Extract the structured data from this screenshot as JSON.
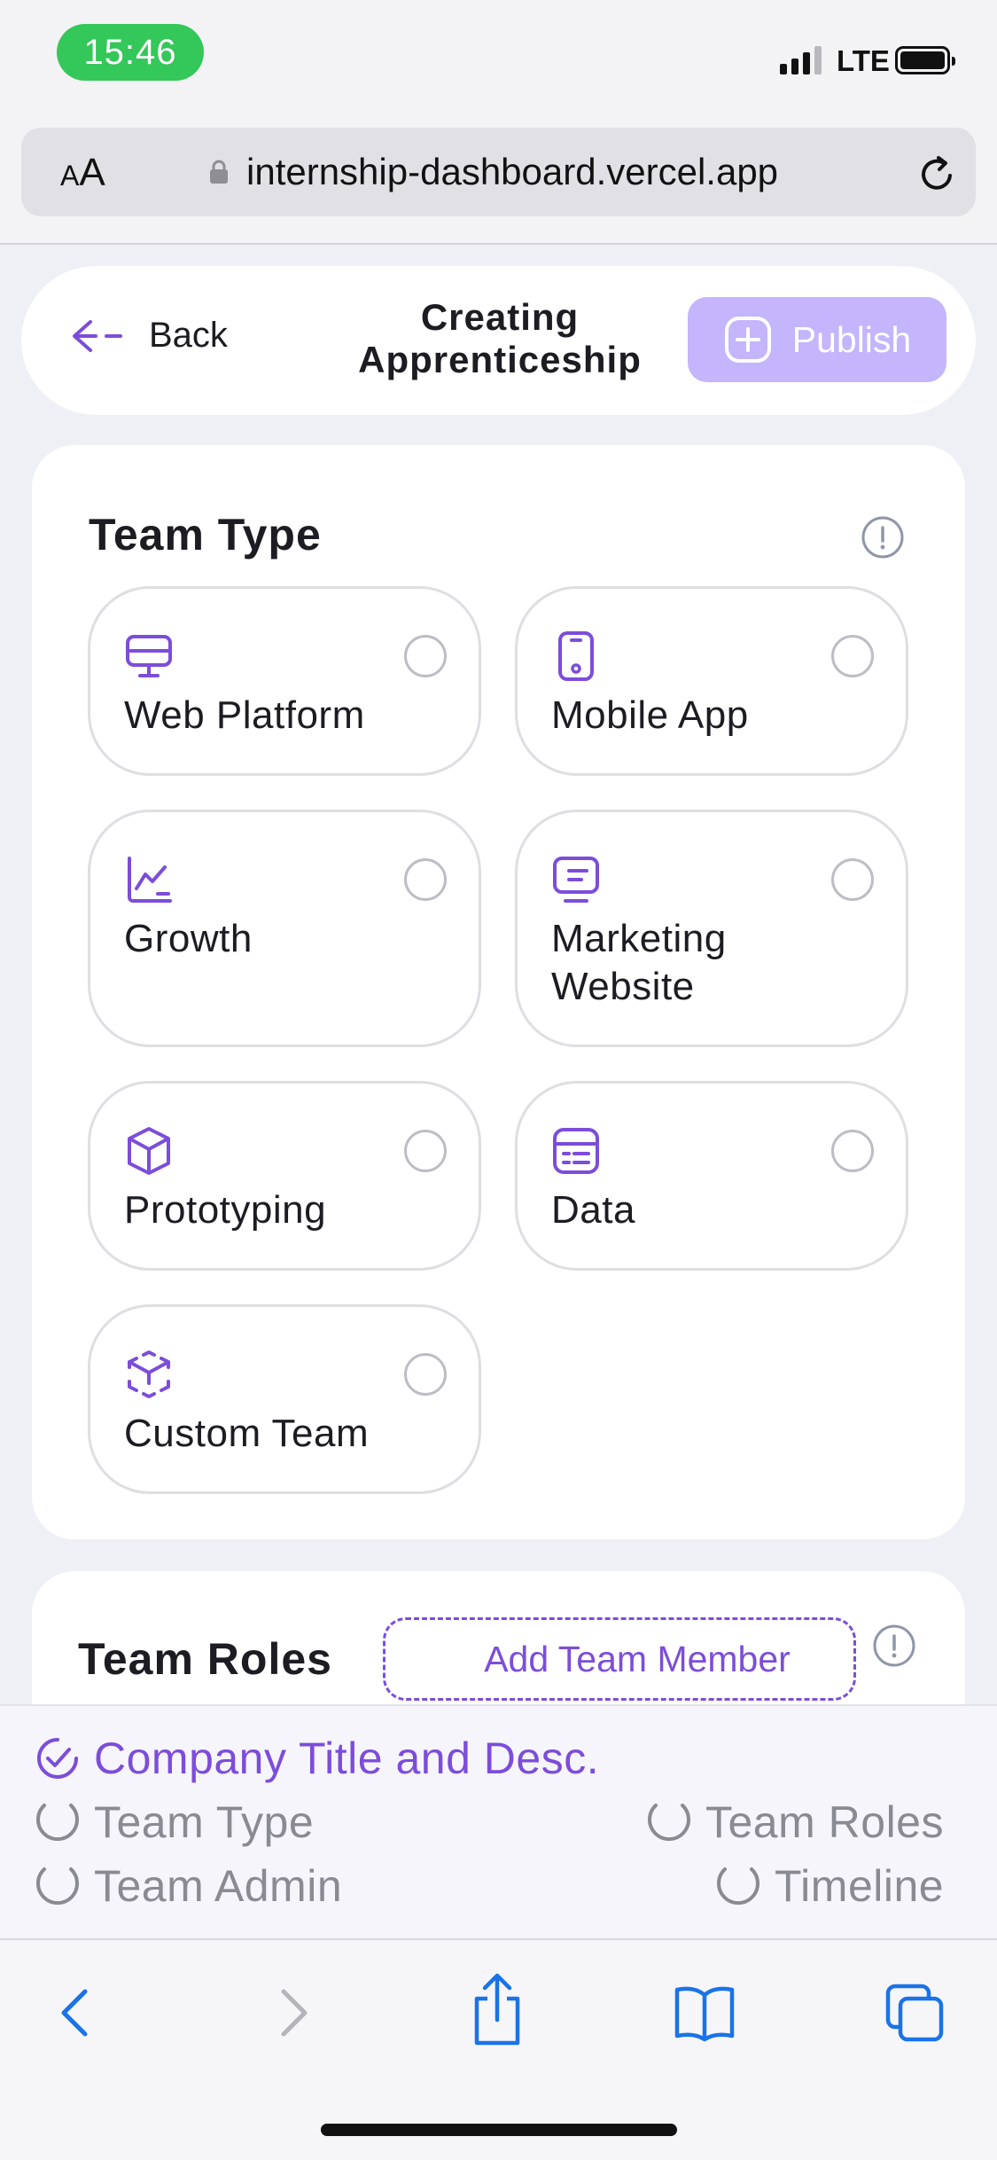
{
  "status_bar": {
    "time": "15:46",
    "network": "LTE"
  },
  "browser": {
    "aa_label": "AA",
    "url": "internship-dashboard.vercel.app"
  },
  "header": {
    "back_label": "Back",
    "title_line1": "Creating",
    "title_line2": "Apprenticeship",
    "publish_label": "Publish"
  },
  "team_type": {
    "title": "Team Type",
    "options": [
      {
        "label": "Web Platform",
        "icon": "monitor-icon",
        "selected": false
      },
      {
        "label": "Mobile App",
        "icon": "smartphone-icon",
        "selected": false
      },
      {
        "label": "Growth",
        "icon": "chart-line-icon",
        "selected": false
      },
      {
        "label_line1": "Marketing",
        "label_line2": "Website",
        "icon": "screen-text-icon",
        "selected": false
      },
      {
        "label": "Prototyping",
        "icon": "cube-icon",
        "selected": false
      },
      {
        "label": "Data",
        "icon": "table-icon",
        "selected": false
      },
      {
        "label": "Custom Team",
        "icon": "dashed-cube-icon",
        "selected": false
      }
    ]
  },
  "team_roles": {
    "title": "Team Roles",
    "add_member_label": "Add Team Member"
  },
  "progress_steps": [
    {
      "label": "Company Title and Desc.",
      "state": "done"
    },
    {
      "label": "Team Type",
      "state": "pending"
    },
    {
      "label": "Team Roles",
      "state": "pending"
    },
    {
      "label": "Team Admin",
      "state": "pending"
    },
    {
      "label": "Timeline",
      "state": "pending"
    }
  ],
  "colors": {
    "accent": "#7c4dda",
    "accent_light": "#c4b5fd",
    "ios_blue": "#1a73e8",
    "status_green": "#34c759"
  }
}
